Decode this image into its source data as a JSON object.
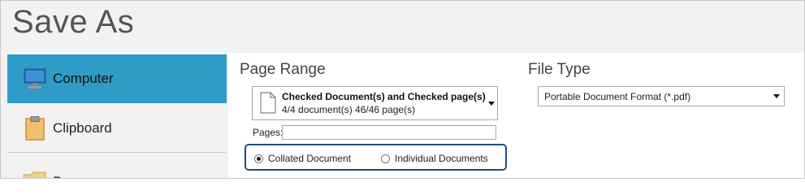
{
  "window": {
    "title": "Save As"
  },
  "sidebar": {
    "items": [
      {
        "label": "Computer",
        "icon": "monitor-icon",
        "active": true
      },
      {
        "label": "Clipboard",
        "icon": "clipboard-icon",
        "active": false
      },
      {
        "label": "B",
        "icon": "folder-icon",
        "active": false
      }
    ]
  },
  "page_range": {
    "heading": "Page Range",
    "selection": {
      "title": "Checked Document(s) and Checked page(s)",
      "detail": "4/4 document(s) 46/46 page(s)"
    },
    "pages_label": "Pages:",
    "pages_value": "",
    "options": [
      {
        "label": "Collated Document",
        "checked": true
      },
      {
        "label": "Individual Documents",
        "checked": false
      }
    ]
  },
  "file_type": {
    "heading": "File Type",
    "value": "Portable Document Format (*.pdf)"
  },
  "colors": {
    "active_nav": "#2e9cc6",
    "focus_border": "#1f4e79",
    "panel_bg": "#f2f2f2"
  }
}
